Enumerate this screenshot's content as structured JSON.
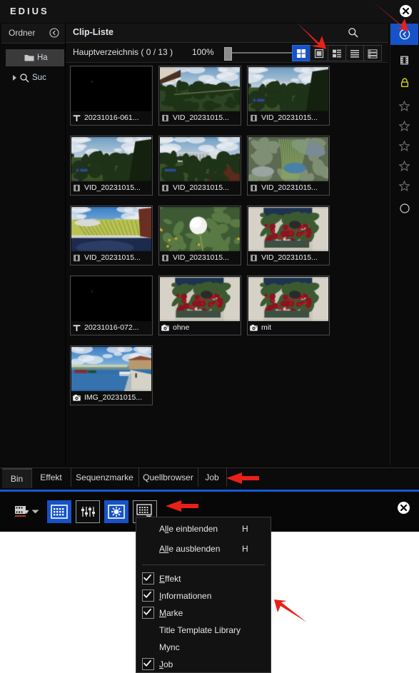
{
  "window": {
    "app_title": "EDIUS",
    "close_label": "✕"
  },
  "folder_panel": {
    "title": "Ordner",
    "collapse_icon": "chevron-left-circle-icon",
    "items": [
      {
        "label": "Ha",
        "icon": "folder-icon",
        "selected": true
      },
      {
        "label": "Suc",
        "icon": "search-icon",
        "selected": false
      }
    ]
  },
  "clip_list": {
    "title": "Clip-Liste",
    "search_icon": "search-icon",
    "path": "Hauptverzeichnis ( 0 / 13 )",
    "zoom": "100%",
    "view_modes": [
      {
        "name": "grid-view",
        "active": true
      },
      {
        "name": "large-tile-view",
        "active": false
      },
      {
        "name": "tile-detail-view",
        "active": false
      },
      {
        "name": "list-view",
        "active": false
      },
      {
        "name": "detail-list-view",
        "active": false
      }
    ],
    "clips": [
      {
        "name": "20231016-061...",
        "type": "title",
        "icon": "title-icon"
      },
      {
        "name": "VID_20231015...",
        "type": "video",
        "icon": "film-icon"
      },
      {
        "name": "VID_20231015...",
        "type": "video",
        "icon": "film-icon"
      },
      {
        "name": "VID_20231015...",
        "type": "video",
        "icon": "film-icon"
      },
      {
        "name": "VID_20231015...",
        "type": "video",
        "icon": "film-icon"
      },
      {
        "name": "VID_20231015...",
        "type": "video",
        "icon": "film-icon"
      },
      {
        "name": "VID_20231015...",
        "type": "video",
        "icon": "film-icon"
      },
      {
        "name": "VID_20231015...",
        "type": "video",
        "icon": "film-icon"
      },
      {
        "name": "VID_20231015...",
        "type": "video",
        "icon": "film-icon"
      },
      {
        "name": "20231016-072...",
        "type": "title",
        "icon": "title-icon"
      },
      {
        "name": "ohne",
        "type": "photo",
        "icon": "camera-icon"
      },
      {
        "name": "mit",
        "type": "photo",
        "icon": "camera-icon"
      },
      {
        "name": "IMG_20231015...",
        "type": "photo",
        "icon": "camera-icon"
      }
    ]
  },
  "right_rail": {
    "buttons": [
      {
        "name": "collapse-panel-button",
        "icon": "chevron-left-circle-icon",
        "active": true
      },
      {
        "name": "film-button",
        "icon": "film-icon",
        "active": false
      },
      {
        "name": "lock-button",
        "icon": "lock-icon",
        "active": false
      },
      {
        "name": "rating-1",
        "icon": "star-icon",
        "active": false
      },
      {
        "name": "rating-2",
        "icon": "star-icon",
        "active": false
      },
      {
        "name": "rating-3",
        "icon": "star-icon",
        "active": false
      },
      {
        "name": "rating-4",
        "icon": "star-icon",
        "active": false
      },
      {
        "name": "rating-5",
        "icon": "star-icon",
        "active": false
      },
      {
        "name": "no-rating",
        "icon": "circle-icon",
        "active": false
      }
    ]
  },
  "tabs": [
    {
      "label": "Bin",
      "active": true
    },
    {
      "label": "Effekt",
      "active": false
    },
    {
      "label": "Sequenzmarke",
      "active": false
    },
    {
      "label": "Quellbrowser",
      "active": false
    },
    {
      "label": "Job",
      "active": false
    }
  ],
  "toolbar": {
    "buttons": [
      {
        "name": "source-button",
        "icon": "clapperboard-icon",
        "active": false,
        "has_dropdown": true,
        "framed": false
      },
      {
        "name": "bin-button",
        "icon": "bin-grid-icon",
        "active": true,
        "has_dropdown": false,
        "framed": false
      },
      {
        "name": "mixer-button",
        "icon": "sliders-icon",
        "active": false,
        "has_dropdown": false,
        "framed": true
      },
      {
        "name": "palette-button",
        "icon": "burst-icon",
        "active": true,
        "has_dropdown": false,
        "framed": false
      },
      {
        "name": "panels-button",
        "icon": "panel-grid-icon",
        "active": false,
        "has_dropdown": true,
        "framed": true
      }
    ],
    "close_label": "✕"
  },
  "context_menu": {
    "items": [
      {
        "label": "Alle einblenden",
        "underline": "ll",
        "shortcut": "H",
        "checkbox": false,
        "checked": false
      },
      {
        "label": "Alle ausblenden",
        "underline": "All",
        "shortcut": "H",
        "checkbox": false,
        "checked": false
      },
      {
        "separator": true
      },
      {
        "label": "Effekt",
        "underline": "E",
        "shortcut": "",
        "checkbox": true,
        "checked": true
      },
      {
        "label": "Informationen",
        "underline": "I",
        "shortcut": "",
        "checkbox": true,
        "checked": true
      },
      {
        "label": "Marke",
        "underline": "M",
        "shortcut": "",
        "checkbox": true,
        "checked": true
      },
      {
        "label": "Title Template Library",
        "underline": "",
        "shortcut": "",
        "checkbox": false,
        "checked": false
      },
      {
        "label": "Mync",
        "underline": "",
        "shortcut": "",
        "checkbox": false,
        "checked": false
      },
      {
        "label": "Job",
        "underline": "J",
        "shortcut": "",
        "checkbox": true,
        "checked": true
      }
    ]
  },
  "annotations": {
    "arrow_color": "#e8201a",
    "arrows": [
      {
        "name": "arrow-to-view-buttons"
      },
      {
        "name": "arrow-to-collapse-button"
      },
      {
        "name": "arrow-to-job-tab"
      },
      {
        "name": "arrow-to-panels-button"
      },
      {
        "name": "arrow-to-menu"
      }
    ]
  }
}
